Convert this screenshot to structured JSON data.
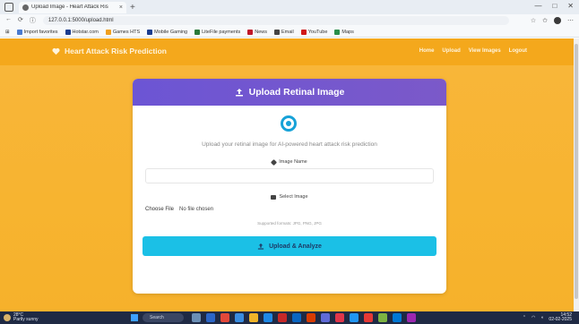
{
  "browser": {
    "tab_title": "Upload Image - Heart Attack Ris",
    "tab_close": "×",
    "new_tab": "+",
    "window_controls": [
      "—",
      "□",
      "✕"
    ],
    "url": "127.0.0.1:5000/upload.html",
    "bookmarks": [
      {
        "label": "Import favorites",
        "color": "#4a7bd0"
      },
      {
        "label": "Hotstar.com",
        "color": "#1b3d8f"
      },
      {
        "label": "Games HTS",
        "color": "#f0a020"
      },
      {
        "label": "Mobile Gaming",
        "color": "#1b3d8f"
      },
      {
        "label": "LiteFile payments",
        "color": "#2a7a3a"
      },
      {
        "label": "News",
        "color": "#c0182a"
      },
      {
        "label": "Email",
        "color": "#444444"
      },
      {
        "label": "YouTube",
        "color": "#d01818"
      },
      {
        "label": "Maps",
        "color": "#2a8f4a"
      }
    ]
  },
  "navbar": {
    "brand": "Heart Attack Risk Prediction",
    "links": [
      "Home",
      "Upload",
      "View Images",
      "Logout"
    ]
  },
  "card": {
    "title": "Upload Retinal Image",
    "subtitle": "Upload your retinal image for AI-powered heart attack risk prediction",
    "name_label": "Image Name",
    "name_value": "",
    "image_label": "Select Image",
    "choose_file": "Choose File",
    "no_file": "No file chosen",
    "supported": "Supported formats: JPG, PNG, JPG",
    "submit": "Upload & Analyze"
  },
  "taskbar": {
    "weather_temp": "28°C",
    "weather_desc": "Partly sunny",
    "search_placeholder": "Search",
    "time": "14:52",
    "date": "02-02-2025",
    "app_colors": [
      "#6b8fb5",
      "#2c66c7",
      "#e2483a",
      "#3a8de0",
      "#f0b429",
      "#1e88e5",
      "#c62828",
      "#0a66c2",
      "#d83b01",
      "#5f6ad6",
      "#e0364a",
      "#2196f3",
      "#e53935",
      "#7cb342",
      "#0078d4",
      "#9c27b0"
    ]
  },
  "colors": {
    "page_bg": "#f7b430",
    "header_gradient_start": "#6c55d4",
    "submit_bg": "#1bc0e6",
    "accent": "#17a2d8"
  }
}
